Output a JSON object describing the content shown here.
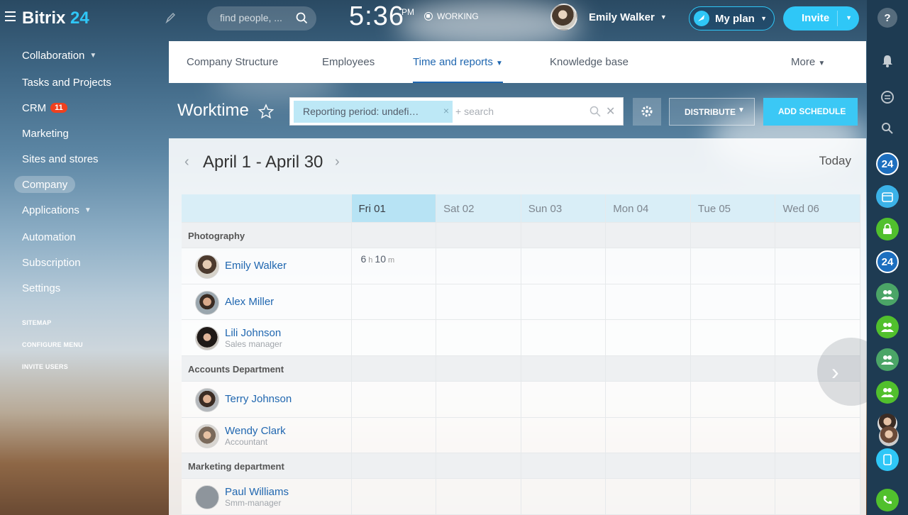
{
  "topbar": {
    "logo_text": "Bitrix",
    "logo_num": "24",
    "search_placeholder": "find people, ...",
    "time": "5:36",
    "ampm": "PM",
    "work_status": "WORKING",
    "user_name": "Emily Walker",
    "myplan_label": "My plan",
    "invite_label": "Invite"
  },
  "sidebar": {
    "items": [
      {
        "label": "Collaboration",
        "chevron": true
      },
      {
        "label": "Tasks and Projects"
      },
      {
        "label": "CRM",
        "badge": "11"
      },
      {
        "label": "Marketing"
      },
      {
        "label": "Sites and stores"
      },
      {
        "label": "Company",
        "active": true
      },
      {
        "label": "Applications",
        "chevron": true
      },
      {
        "label": "Automation"
      },
      {
        "label": "Subscription"
      },
      {
        "label": "Settings"
      }
    ],
    "links": [
      "SITEMAP",
      "CONFIGURE MENU",
      "INVITE USERS"
    ]
  },
  "tabs": {
    "company_structure": "Company Structure",
    "employees": "Employees",
    "time_and_reports": "Time and reports",
    "knowledge_base": "Knowledge base",
    "more": "More"
  },
  "toolbar": {
    "title": "Worktime",
    "filter_chip": "Reporting period: undefi…",
    "search_placeholder": "+ search",
    "distribute_label": "DISTRIBUTE",
    "add_schedule_label": "ADD SCHEDULE"
  },
  "calendar": {
    "period": "April 1 - April 30",
    "today_label": "Today",
    "days": [
      "Fri 01",
      "Sat 02",
      "Sun 03",
      "Mon 04",
      "Tue 05",
      "Wed 06"
    ],
    "current_day_index": 0
  },
  "groups": [
    {
      "name": "Photography",
      "employees": [
        {
          "name": "Emily Walker",
          "role": "",
          "worked": {
            "h": "6",
            "m": "10"
          }
        },
        {
          "name": "Alex Miller",
          "role": ""
        },
        {
          "name": "Lili Johnson",
          "role": "Sales manager"
        }
      ]
    },
    {
      "name": "Accounts Department",
      "employees": [
        {
          "name": "Terry Johnson",
          "role": ""
        },
        {
          "name": "Wendy Clark",
          "role": "Accountant"
        }
      ]
    },
    {
      "name": "Marketing department",
      "employees": [
        {
          "name": "Paul Williams",
          "role": "Smm-manager"
        }
      ]
    }
  ],
  "right_rail": {
    "icons": [
      "help-icon",
      "bell-icon",
      "chat-icon",
      "search-icon",
      "bitrix24-icon",
      "calendar-icon",
      "lock-icon",
      "bitrix24-icon",
      "group-icon",
      "group-icon",
      "group-icon",
      "group-icon",
      "avatar",
      "avatar",
      "phone-app-icon",
      "call-icon"
    ],
    "labels": {
      "b24": "24"
    }
  },
  "units": {
    "h": "h",
    "m": "m"
  },
  "colors": {
    "accent": "#2fc7f7",
    "link": "#2067b0",
    "badge": "#f0401e"
  }
}
